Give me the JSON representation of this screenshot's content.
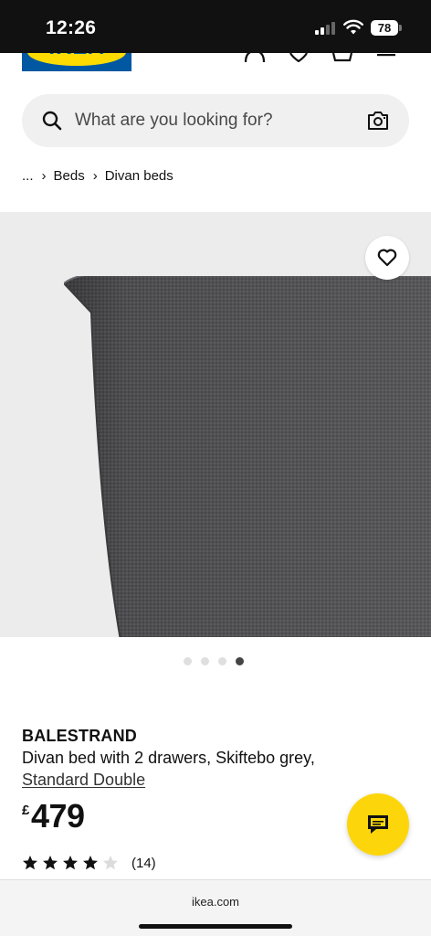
{
  "status_bar": {
    "time": "12:26",
    "battery": "78",
    "signal_icon": "cellular-signal-icon",
    "wifi_icon": "wifi-icon"
  },
  "header": {
    "logo_text": "IKEA",
    "icons": [
      "profile-icon",
      "heart-icon",
      "basket-icon",
      "menu-icon"
    ]
  },
  "search": {
    "placeholder": "What are you looking for?",
    "icon": "search-icon",
    "camera_icon": "camera-icon"
  },
  "breadcrumb": {
    "ellipsis": "...",
    "items": [
      "Beds",
      "Divan beds"
    ]
  },
  "gallery": {
    "slide_count": 4,
    "active_index": 3,
    "wishlist_icon": "heart-outline-icon"
  },
  "product": {
    "name": "BALESTRAND",
    "description": "Divan bed with 2 drawers, Skiftebo grey,",
    "size": "Standard Double",
    "currency": "£",
    "price": "479",
    "rating": 4,
    "rating_max": 5,
    "review_count": "(14)"
  },
  "chat": {
    "icon": "chat-bubble-icon"
  },
  "browser": {
    "url": "ikea.com"
  },
  "colors": {
    "ikea_blue": "#0058a3",
    "ikea_yellow": "#ffdb00",
    "chat_yellow": "#fcd60b",
    "fabric_grey": "#535356"
  }
}
